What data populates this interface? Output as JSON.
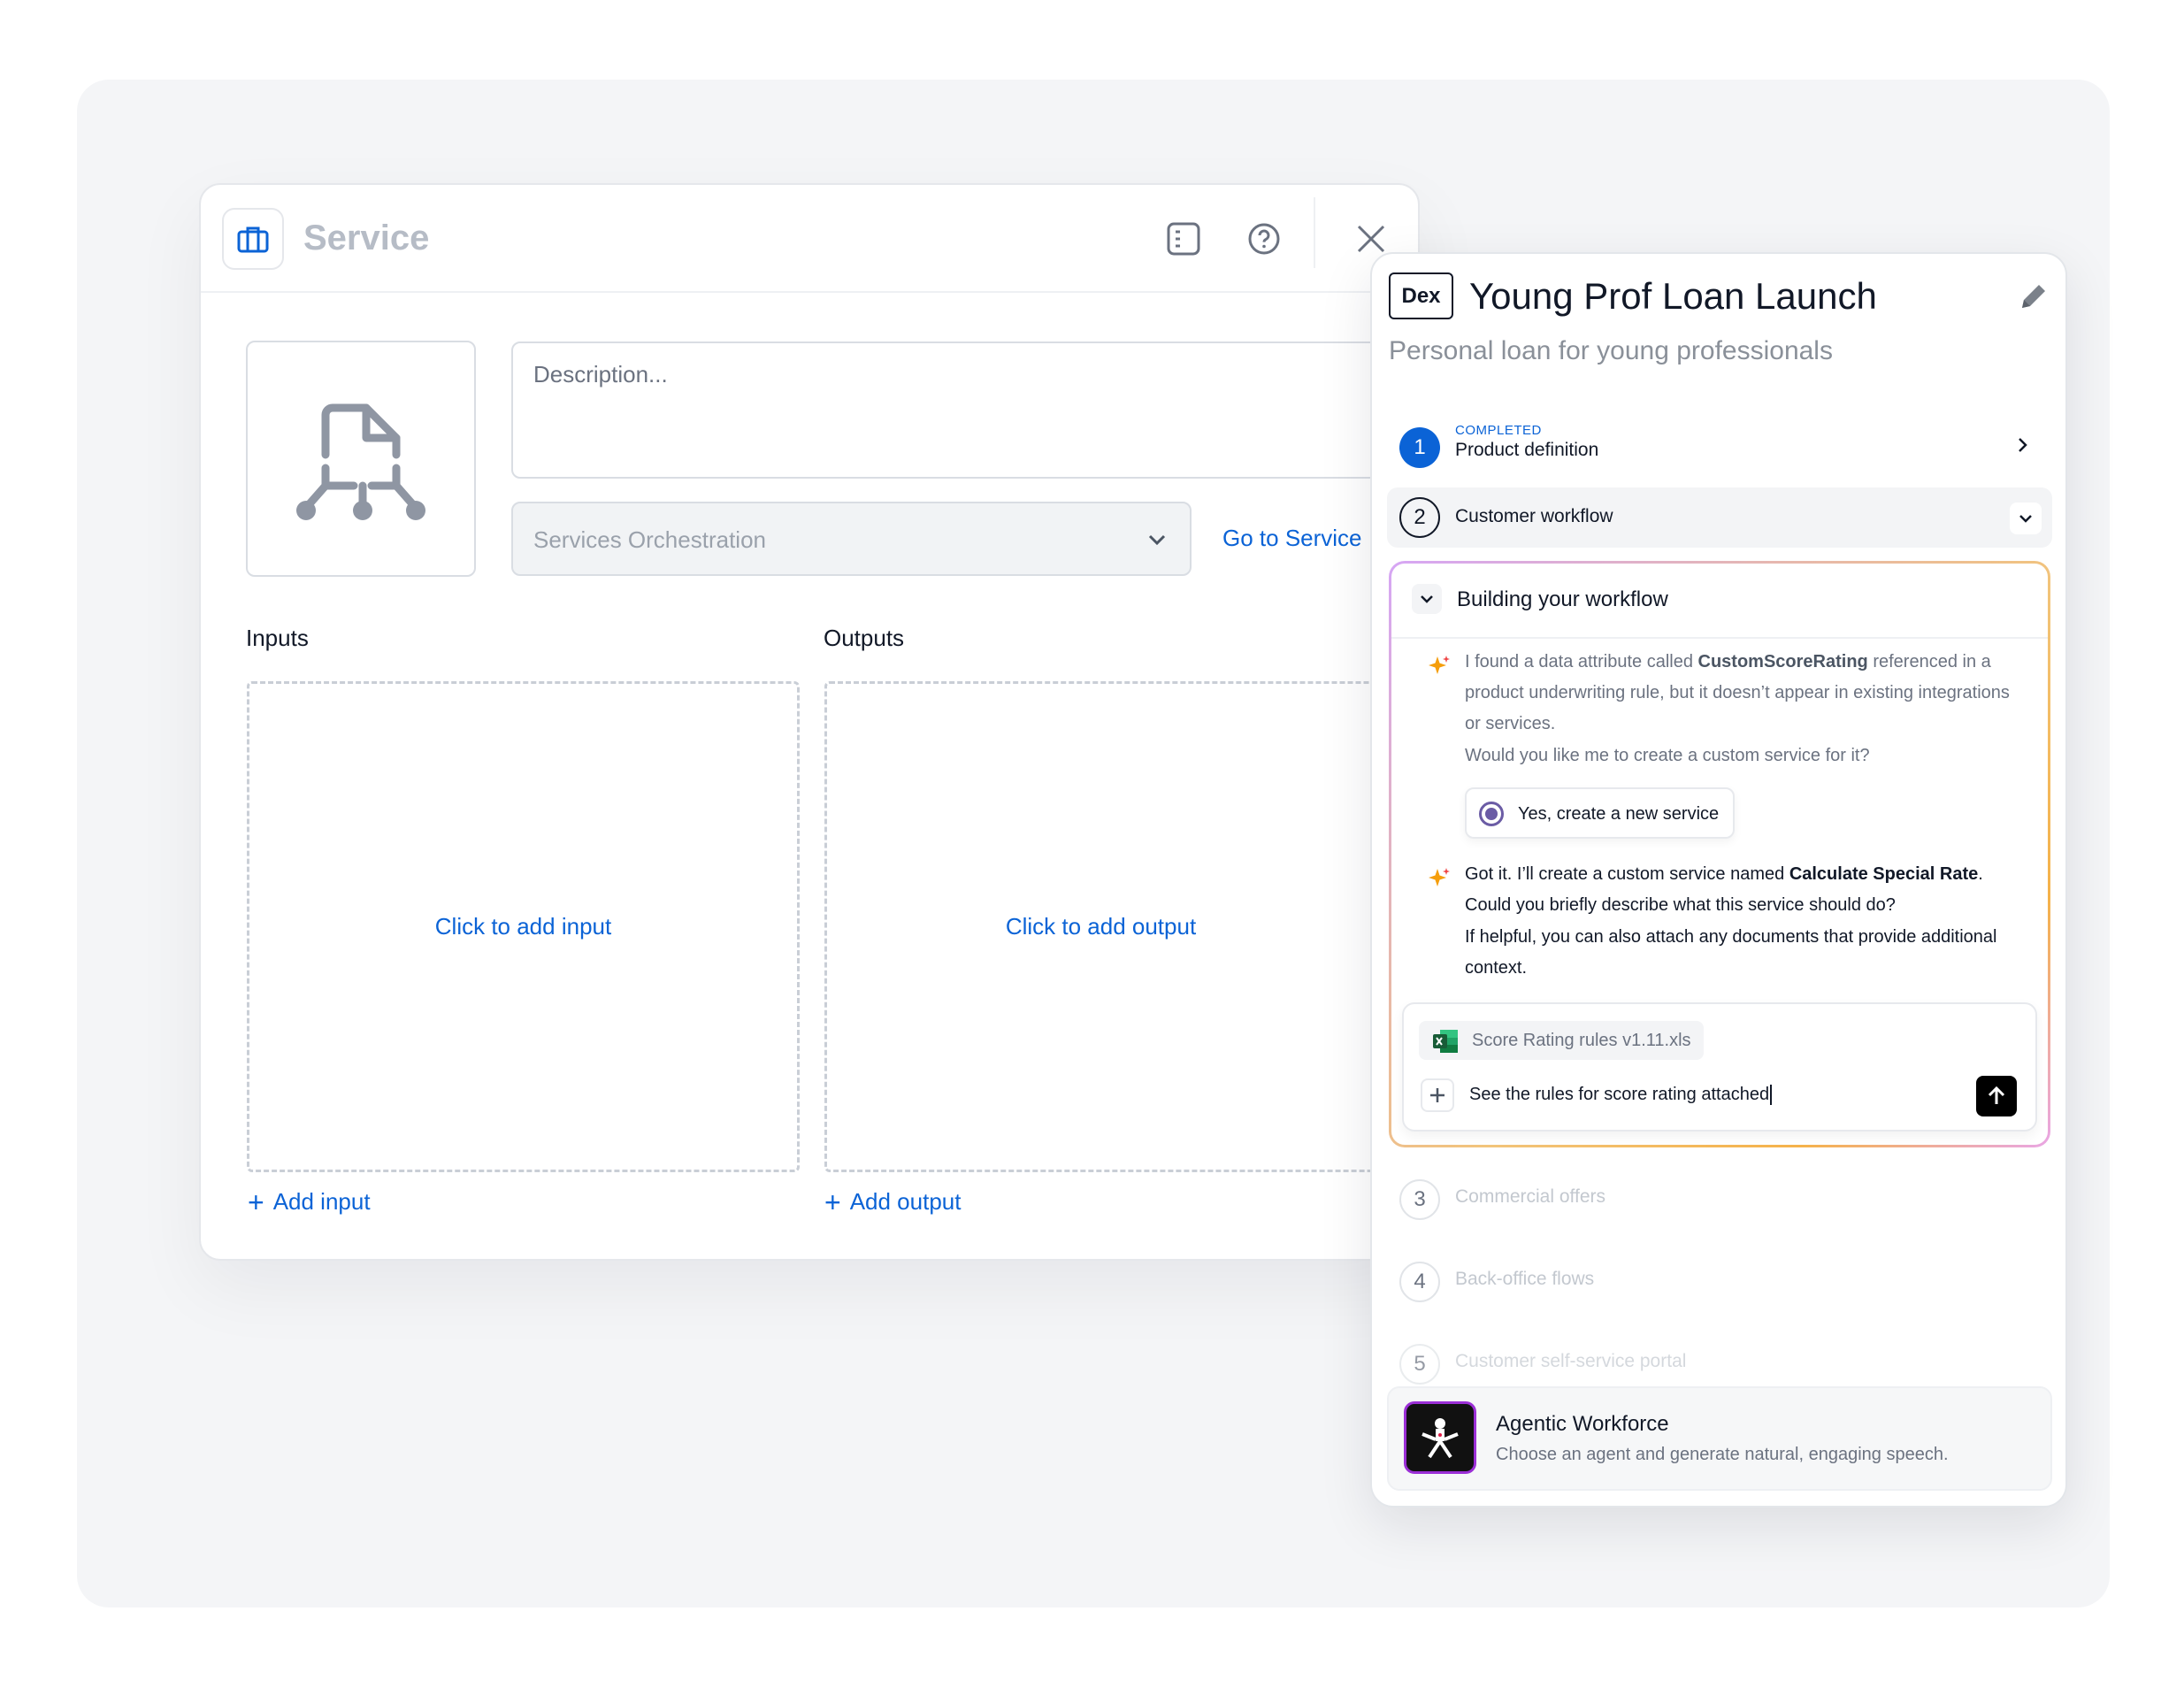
{
  "service": {
    "title": "Service",
    "description_placeholder": "Description...",
    "orchestration_value": "Services Orchestration",
    "go_to_service": "Go to Service",
    "inputs_label": "Inputs",
    "outputs_label": "Outputs",
    "add_input_area": "Click to add input",
    "add_output_area": "Click to add output",
    "add_input": "Add input",
    "add_output": "Add output"
  },
  "dex": {
    "badge": "Dex",
    "title": "Young Prof Loan Launch",
    "subtitle": "Personal loan for young professionals",
    "steps": [
      {
        "num": "1",
        "status": "COMPLETED",
        "name": "Product definition"
      },
      {
        "num": "2",
        "name": "Customer workflow"
      },
      {
        "num": "3",
        "name": "Commercial offers"
      },
      {
        "num": "4",
        "name": "Back-office flows"
      },
      {
        "num": "5",
        "name": "Customer self-service portal"
      }
    ],
    "building": {
      "title": "Building your workflow",
      "msg1_a": "I found a data attribute called ",
      "msg1_b": "CustomScoreRating",
      "msg1_c": " referenced in a product underwriting rule, but it doesn’t appear in existing integrations or services.",
      "msg1_q": "Would you like me to create a custom service for it?",
      "choice": "Yes, create a new service",
      "msg2_a": "Got it. I’ll create a custom service named ",
      "msg2_b": "Calculate Special Rate",
      "msg2_c": ". Could you briefly describe what this service should do?",
      "msg2_d": "If helpful, you can also attach any documents that provide additional context.",
      "attachment": "Score Rating rules v1.11.xls",
      "composer_text": "See the rules for score rating attached"
    },
    "agent": {
      "title": "Agentic Workforce",
      "subtitle": "Choose an agent and generate natural, engaging speech."
    }
  }
}
